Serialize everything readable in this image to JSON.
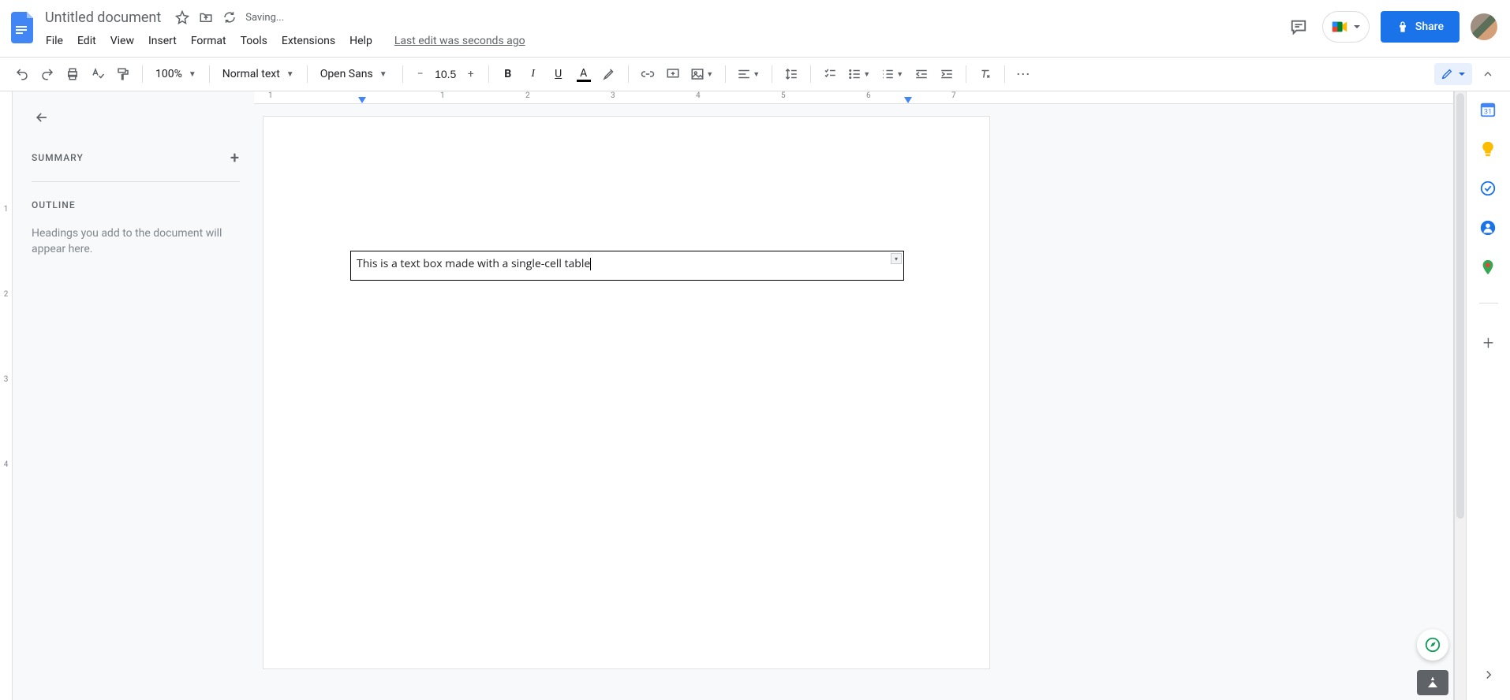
{
  "header": {
    "title": "Untitled document",
    "saving": "Saving...",
    "last_edit": "Last edit was seconds ago",
    "menus": [
      "File",
      "Edit",
      "View",
      "Insert",
      "Format",
      "Tools",
      "Extensions",
      "Help"
    ],
    "share_label": "Share"
  },
  "toolbar": {
    "zoom": "100%",
    "style": "Normal text",
    "font": "Open Sans",
    "font_size": "10.5"
  },
  "ruler": {
    "h_numbers": [
      "1",
      "1",
      "2",
      "3",
      "4",
      "5",
      "6",
      "7"
    ]
  },
  "outline": {
    "summary_label": "SUMMARY",
    "outline_label": "OUTLINE",
    "help_text": "Headings you add to the document will appear here."
  },
  "document": {
    "table_text": "This is a text box made with a single-cell table"
  }
}
